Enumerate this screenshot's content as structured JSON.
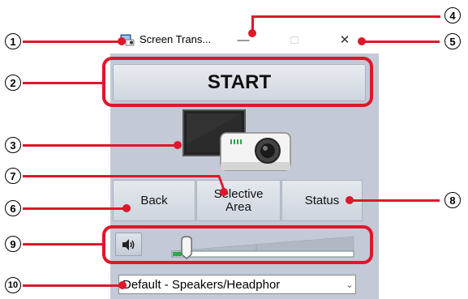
{
  "window": {
    "title": "Screen Trans...",
    "minimize_symbol": "—",
    "maximize_symbol": "□",
    "close_symbol": "✕"
  },
  "start_button": {
    "label": "START"
  },
  "device_icon": "display-projector-icon",
  "nav": {
    "back_label": "Back",
    "selective_area_label": "Selective Area",
    "status_label": "Status"
  },
  "volume": {
    "mute_icon": "speaker-icon",
    "level_fraction": 0.05
  },
  "output_device": {
    "selected": "Default - Speakers/Headphor",
    "arrow": "⌄"
  },
  "callouts": [
    "1",
    "2",
    "3",
    "4",
    "5",
    "6",
    "7",
    "8",
    "9",
    "10"
  ],
  "colors": {
    "accent_red": "#e0162b",
    "window_bg": "#c3c9d6",
    "button_face": "#dfe3ea"
  }
}
